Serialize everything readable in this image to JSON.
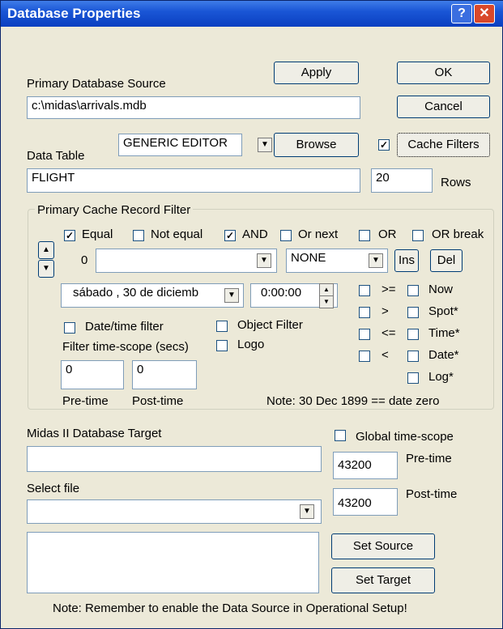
{
  "window": {
    "title": "Database Properties"
  },
  "buttons": {
    "apply": "Apply",
    "ok": "OK",
    "cancel": "Cancel",
    "browse": "Browse",
    "cache_filters": "Cache Filters",
    "ins": "Ins",
    "del": "Del",
    "set_source": "Set Source",
    "set_target": "Set Target"
  },
  "source": {
    "label": "Primary Database Source",
    "value": "c:\\midas\\arrivals.mdb"
  },
  "data_table": {
    "label": "Data Table",
    "editor": "GENERIC EDITOR",
    "value": "FLIGHT",
    "rows_value": "20",
    "rows_label": "Rows"
  },
  "filter": {
    "group_title": "Primary Cache Record Filter",
    "equal": "Equal",
    "not_equal": "Not equal",
    "and": "AND",
    "or_next": "Or next",
    "or": "OR",
    "or_break": "OR break",
    "field_index": "0",
    "operator_select": "NONE",
    "date_value": "sábado , 30 de diciemb",
    "time_value": "0:00:00",
    "date_time_filter": "Date/time filter",
    "object_filter": "Object Filter",
    "logo": "Logo",
    "scope_label": "Filter time-scope (secs)",
    "pre_value": "0",
    "post_value": "0",
    "pre_label": "Pre-time",
    "post_label": "Post-time",
    "ge": ">=",
    "gt": ">",
    "le": "<=",
    "lt": "<",
    "now": "Now",
    "spot": "Spot*",
    "time": "Time*",
    "date": "Date*",
    "log": "Log*",
    "note": "Note: 30 Dec 1899 == date zero"
  },
  "target": {
    "label": "Midas II Database Target",
    "value": "",
    "global_scope": "Global time-scope",
    "pre_value": "43200",
    "pre_label": "Pre-time",
    "post_value": "43200",
    "post_label": "Post-time",
    "select_label": "Select file",
    "select_value": ""
  },
  "footer_note": "Note:  Remember to enable the Data Source in Operational Setup!"
}
